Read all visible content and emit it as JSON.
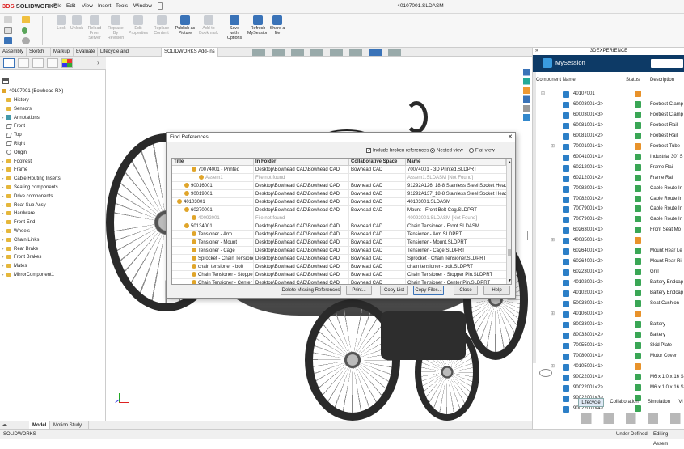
{
  "app": {
    "logo_brand": "3DS",
    "logo_name": "SOLIDWORKS",
    "doc_title": "40107001.SLDASM"
  },
  "menus": [
    "File",
    "Edit",
    "View",
    "Insert",
    "Tools",
    "Window"
  ],
  "ribbon": [
    {
      "label": "Lock",
      "enabled": false
    },
    {
      "label": "Unlock",
      "enabled": false
    },
    {
      "label": "Reload\nFrom\nServer",
      "enabled": false
    },
    {
      "label": "Replace\nBy\nRevision",
      "enabled": false
    },
    {
      "label": "Edit\nProperties",
      "enabled": false
    },
    {
      "label": "Replace\nContent",
      "enabled": false
    },
    {
      "label": "Publish as\nPicture",
      "enabled": true
    },
    {
      "label": "Add to\nBookmark",
      "enabled": false
    },
    {
      "label": "Save\nwith\nOptions",
      "enabled": true
    },
    {
      "label": "Refresh\nMySession",
      "enabled": true
    },
    {
      "label": "Share a\nfile",
      "enabled": true
    }
  ],
  "command_tabs": [
    "Assembly",
    "Sketch",
    "Markup",
    "Evaluate",
    "Lifecycle and Collaboration",
    "SOLIDWORKS Add-Ins"
  ],
  "active_command_tab": "SOLIDWORKS Add-Ins",
  "tree": {
    "root": "40107001 (Bowhead RX)",
    "items": [
      {
        "label": "History",
        "kind": "folder",
        "expand": false
      },
      {
        "label": "Sensors",
        "kind": "folder",
        "expand": false
      },
      {
        "label": "Annotations",
        "kind": "annot",
        "expand": true
      },
      {
        "label": "Front",
        "kind": "plane",
        "expand": false
      },
      {
        "label": "Top",
        "kind": "plane",
        "expand": false
      },
      {
        "label": "Right",
        "kind": "plane",
        "expand": false
      },
      {
        "label": "Origin",
        "kind": "origin",
        "expand": false
      },
      {
        "label": "Footrest",
        "kind": "folder",
        "expand": true
      },
      {
        "label": "Frame",
        "kind": "folder",
        "expand": true
      },
      {
        "label": "Cable Routing Inserts",
        "kind": "folder",
        "expand": true
      },
      {
        "label": "Seating components",
        "kind": "folder",
        "expand": true
      },
      {
        "label": "Drive components",
        "kind": "folder",
        "expand": true
      },
      {
        "label": "Rear Sub Assy",
        "kind": "folder",
        "expand": true
      },
      {
        "label": "Hardware",
        "kind": "folder",
        "expand": true
      },
      {
        "label": "Front End",
        "kind": "folder",
        "expand": true
      },
      {
        "label": "Wheels",
        "kind": "folder",
        "expand": true
      },
      {
        "label": "Chain Links",
        "kind": "folder",
        "expand": true
      },
      {
        "label": "Rear Brake",
        "kind": "folder",
        "expand": true
      },
      {
        "label": "Front Brakes",
        "kind": "folder",
        "expand": true
      },
      {
        "label": "Mates",
        "kind": "folder",
        "expand": true
      },
      {
        "label": "MirrorComponent1",
        "kind": "folder",
        "expand": true
      }
    ]
  },
  "bottom_tabs": [
    "Model",
    "Motion Study 1"
  ],
  "status": {
    "left": "SOLIDWORKS",
    "mid": "Under Defined",
    "right": "Editing Assem"
  },
  "right_panel": {
    "header": "3DEXPERIENCE",
    "title": "MySession",
    "columns": [
      "Component Name",
      "Status",
      "Description"
    ],
    "rows": [
      {
        "name": "40107001",
        "status": "lock",
        "desc": ""
      },
      {
        "name": "60003001<2>",
        "status": "ok",
        "desc": "Footrest Clamp"
      },
      {
        "name": "60003001<3>",
        "status": "ok",
        "desc": "Footrest Clamp"
      },
      {
        "name": "60081001<1>",
        "status": "ok",
        "desc": "Footrest Rail"
      },
      {
        "name": "60081001<2>",
        "status": "ok",
        "desc": "Footrest Rail"
      },
      {
        "name": "70001001<1>",
        "status": "lock",
        "desc": "Footrest Tube"
      },
      {
        "name": "60041001<1>",
        "status": "ok",
        "desc": "Industrial 30\" S"
      },
      {
        "name": "60212001<1>",
        "status": "ok",
        "desc": "Frame Rail"
      },
      {
        "name": "60212001<2>",
        "status": "ok",
        "desc": "Frame Rail"
      },
      {
        "name": "70082001<1>",
        "status": "ok",
        "desc": "Cable Route In"
      },
      {
        "name": "70082001<2>",
        "status": "ok",
        "desc": "Cable Route In"
      },
      {
        "name": "70079001<1>",
        "status": "ok",
        "desc": "Cable Route In"
      },
      {
        "name": "70079001<2>",
        "status": "ok",
        "desc": "Cable Route In"
      },
      {
        "name": "60263001<1>",
        "status": "ok",
        "desc": "Front Seat Mo"
      },
      {
        "name": "40085001<1>",
        "status": "lock",
        "desc": ""
      },
      {
        "name": "60264001<1>",
        "status": "ok",
        "desc": "Mount Rear Le"
      },
      {
        "name": "60264001<2>",
        "status": "ok",
        "desc": "Mount Rear Ri"
      },
      {
        "name": "60223001<1>",
        "status": "ok",
        "desc": "Grill"
      },
      {
        "name": "40102001<2>",
        "status": "ok",
        "desc": "Battery Endcap"
      },
      {
        "name": "40102001<1>",
        "status": "ok",
        "desc": "Battery Endcap"
      },
      {
        "name": "50038001<1>",
        "status": "ok",
        "desc": "Seat Cushion"
      },
      {
        "name": "40106001<1>",
        "status": "lock",
        "desc": ""
      },
      {
        "name": "80033001<1>",
        "status": "ok",
        "desc": "Battery"
      },
      {
        "name": "80033001<2>",
        "status": "ok",
        "desc": "Battery"
      },
      {
        "name": "70055001<1>",
        "status": "ok",
        "desc": "Skid Plate"
      },
      {
        "name": "70080001<1>",
        "status": "ok",
        "desc": "Motor Cover"
      },
      {
        "name": "40105001<1>",
        "status": "lock",
        "desc": ""
      },
      {
        "name": "90022001<1>",
        "status": "ok",
        "desc": "M6 x 1.0 x 16 S"
      },
      {
        "name": "90022001<2>",
        "status": "ok",
        "desc": "M6 x 1.0 x 16 S"
      },
      {
        "name": "90022001<3>",
        "status": "ok",
        "desc": ""
      },
      {
        "name": "90022001<4>",
        "status": "ok",
        "desc": ""
      }
    ],
    "tabs": [
      "Lifecycle",
      "Collaboration",
      "Simulation",
      "Vi"
    ]
  },
  "dialog": {
    "title": "Find References",
    "include_broken": "Include broken references",
    "nested": "Nested view",
    "flat": "Flat view",
    "columns": [
      "Title",
      "In Folder",
      "Collaborative Space",
      "Name"
    ],
    "rows": [
      {
        "indent": 2,
        "title": "70074001 - Printed",
        "folder": "Desktop\\Bowhead CAD\\Bowhead CAD",
        "space": "Bowhead CAD",
        "name": "70074001 - 3D Printed.SLDPRT",
        "missing": false
      },
      {
        "indent": 3,
        "title": "Assem1",
        "folder": "File not found",
        "space": "",
        "name": "Assem1.SLDASM [Not Found]",
        "missing": true
      },
      {
        "indent": 1,
        "title": "90016001",
        "folder": "Desktop\\Bowhead CAD\\Bowhead CAD",
        "space": "Bowhead CAD",
        "name": "91292A126_18-8 Stainless Steel Socket Head Sc",
        "missing": false
      },
      {
        "indent": 1,
        "title": "90019001",
        "folder": "Desktop\\Bowhead CAD\\Bowhead CAD",
        "space": "Bowhead CAD",
        "name": "91292A137_18-8 Stainless Steel Socket Head Sc",
        "missing": false
      },
      {
        "indent": 0,
        "title": "40103001",
        "folder": "Desktop\\Bowhead CAD\\Bowhead CAD",
        "space": "Bowhead CAD",
        "name": "40103001.SLDASM",
        "missing": false
      },
      {
        "indent": 1,
        "title": "60270001",
        "folder": "Desktop\\Bowhead CAD\\Bowhead CAD",
        "space": "Bowhead CAD",
        "name": "Mount - Front Belt Cog.SLDPRT",
        "missing": false
      },
      {
        "indent": 2,
        "title": "40092001",
        "folder": "File not found",
        "space": "",
        "name": "40092001.SLDASM [Not Found]",
        "missing": true
      },
      {
        "indent": 1,
        "title": "50134001",
        "folder": "Desktop\\Bowhead CAD\\Bowhead CAD",
        "space": "Bowhead CAD",
        "name": "Chain Tensioner - Front.SLDASM",
        "missing": false
      },
      {
        "indent": 2,
        "title": "Tensioner - Arm",
        "folder": "Desktop\\Bowhead CAD\\Bowhead CAD",
        "space": "Bowhead CAD",
        "name": "Tensioner - Arm.SLDPRT",
        "missing": false
      },
      {
        "indent": 2,
        "title": "Tensioner - Mount",
        "folder": "Desktop\\Bowhead CAD\\Bowhead CAD",
        "space": "Bowhead CAD",
        "name": "Tensioner - Mount.SLDPRT",
        "missing": false
      },
      {
        "indent": 2,
        "title": "Tensioner - Cage",
        "folder": "Desktop\\Bowhead CAD\\Bowhead CAD",
        "space": "Bowhead CAD",
        "name": "Tensioner - Cage.SLDPRT",
        "missing": false
      },
      {
        "indent": 2,
        "title": "Sprocket - Chain Tensioner",
        "folder": "Desktop\\Bowhead CAD\\Bowhead CAD",
        "space": "Bowhead CAD",
        "name": "Sprocket - Chain Tensioner.SLDPRT",
        "missing": false
      },
      {
        "indent": 2,
        "title": "chain tensioner - bolt",
        "folder": "Desktop\\Bowhead CAD\\Bowhead CAD",
        "space": "Bowhead CAD",
        "name": "chain tensioner - bolt.SLDPRT",
        "missing": false
      },
      {
        "indent": 2,
        "title": "Chain Tensioner - Stopper",
        "folder": "Desktop\\Bowhead CAD\\Bowhead CAD",
        "space": "Bowhead CAD",
        "name": "Chain Tensioner - Stopper Pin.SLDPRT",
        "missing": false
      },
      {
        "indent": 2,
        "title": "Chain Tensioner - Center",
        "folder": "Desktop\\Bowhead CAD\\Bowhead CAD",
        "space": "Bowhead CAD",
        "name": "Chain Tensioner - Center Pin.SLDPRT",
        "missing": false
      }
    ],
    "buttons": [
      "Delete Missing References",
      "Print...",
      "Copy List",
      "Copy Files...",
      "Close",
      "Help"
    ]
  },
  "colors": {
    "accent": "#3a73b8",
    "session_bar": "#0d3a66",
    "brand": "#dd2222",
    "ok": "#3aa655",
    "lock": "#e8922a"
  }
}
